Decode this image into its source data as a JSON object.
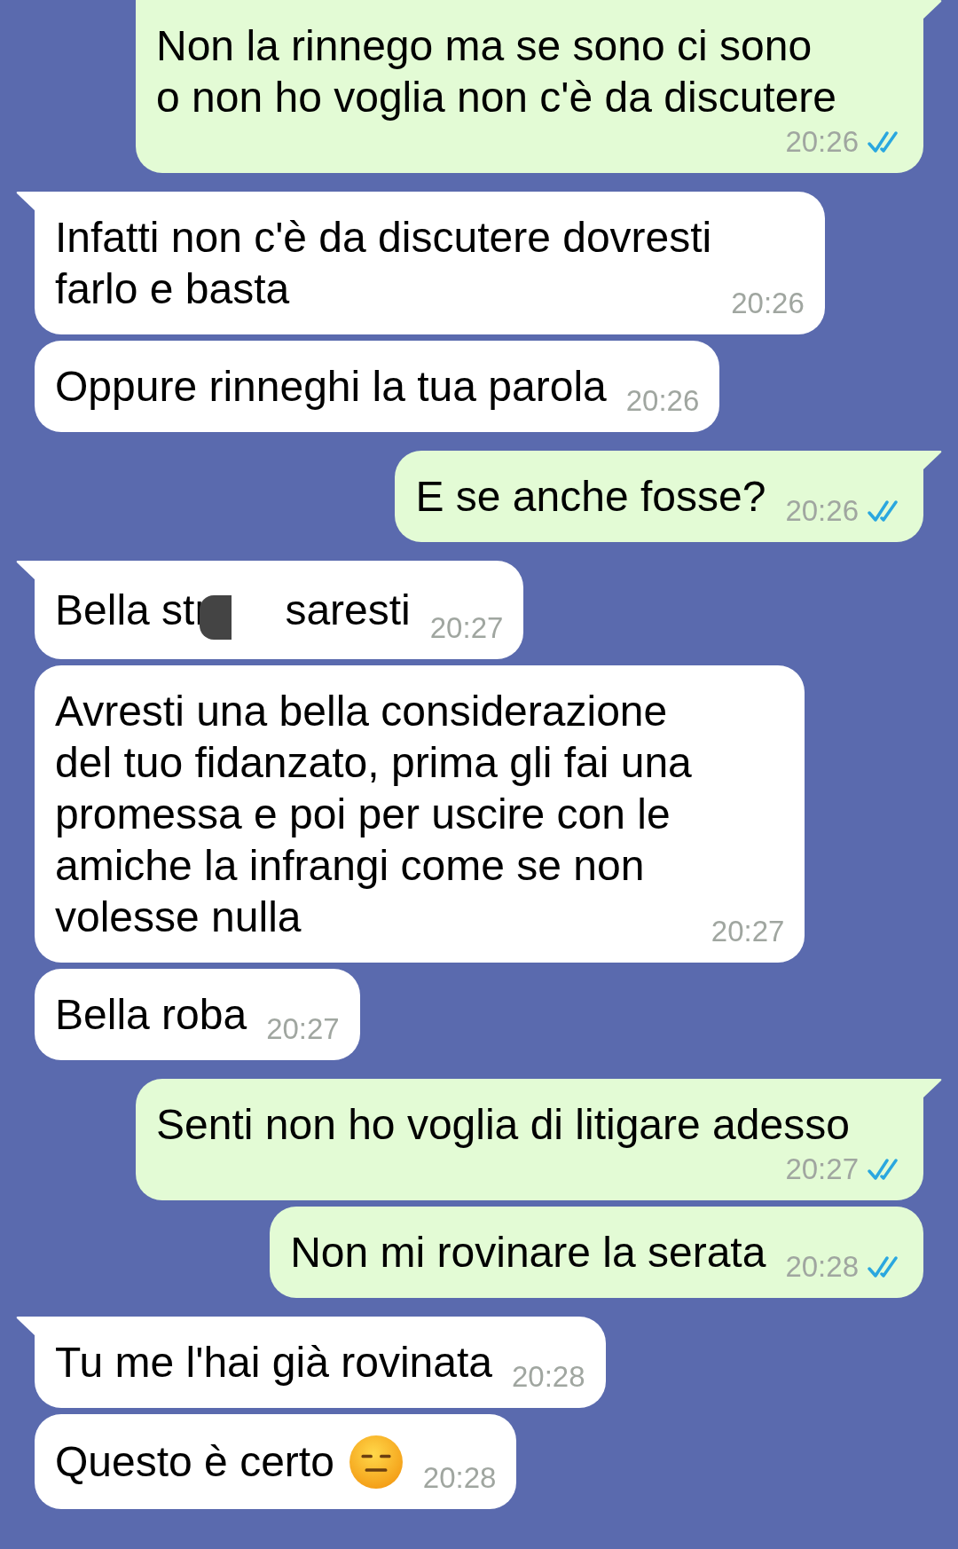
{
  "messages": [
    {
      "outgoing": true,
      "kind": "text",
      "tail": true,
      "text": "Non la rinnego ma se sono ci sono\no non ho voglia non c'è da discutere",
      "time": "20:26",
      "read": true
    },
    {
      "outgoing": false,
      "kind": "text",
      "tail": true,
      "text": "Infatti non c'è da discutere dovresti\nfarlo e basta",
      "time": "20:26"
    },
    {
      "outgoing": false,
      "kind": "text",
      "tail": false,
      "text": "Oppure rinneghi la tua parola",
      "time": "20:26"
    },
    {
      "outgoing": true,
      "kind": "text",
      "tail": true,
      "text": "E se anche fosse?",
      "time": "20:26",
      "read": true
    },
    {
      "outgoing": false,
      "kind": "redacted",
      "tail": true,
      "text": "Bella str",
      "text_after": "saresti",
      "time": "20:27"
    },
    {
      "outgoing": false,
      "kind": "text",
      "tail": false,
      "text": "Avresti una bella considerazione\ndel tuo fidanzato, prima gli fai una\npromessa e poi per uscire con le\namiche la infrangi come se non\nvolesse nulla",
      "time": "20:27"
    },
    {
      "outgoing": false,
      "kind": "text",
      "tail": false,
      "text": "Bella roba",
      "time": "20:27"
    },
    {
      "outgoing": true,
      "kind": "text",
      "tail": true,
      "text": "Senti non ho voglia di litigare adesso",
      "time": "20:27",
      "read": true
    },
    {
      "outgoing": true,
      "kind": "text",
      "tail": false,
      "text": "Non mi rovinare la serata",
      "time": "20:28",
      "read": true
    },
    {
      "outgoing": false,
      "kind": "text",
      "tail": true,
      "text": "Tu me l'hai già rovinata",
      "time": "20:28"
    },
    {
      "outgoing": false,
      "kind": "emoji",
      "tail": false,
      "text": "Questo è certo",
      "time": "20:28"
    }
  ]
}
